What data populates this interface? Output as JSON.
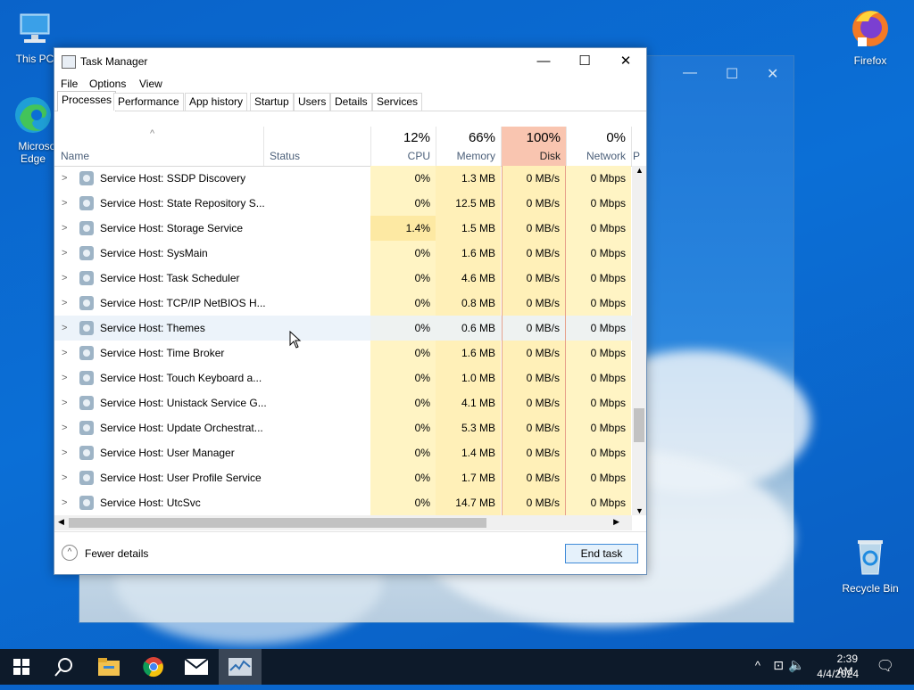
{
  "desktop": {
    "icons": [
      {
        "label": "This PC",
        "icon": "computer-icon"
      },
      {
        "label": "Microsoft Edge",
        "icon": "edge-icon"
      },
      {
        "label": "Firefox",
        "icon": "firefox-icon"
      },
      {
        "label": "Recycle Bin",
        "icon": "recycle-bin-icon"
      }
    ],
    "edge_label_line1": "Microsof",
    "edge_label_line2": "Edge"
  },
  "window": {
    "title": "Task Manager",
    "controls": {
      "minimize": "—",
      "maximize": "☐",
      "close": "✕"
    }
  },
  "menu": [
    "File",
    "Options",
    "View"
  ],
  "tabs": [
    "Processes",
    "Performance",
    "App history",
    "Startup",
    "Users",
    "Details",
    "Services"
  ],
  "active_tab": "Processes",
  "columns": {
    "name": "Name",
    "status": "Status",
    "cpu": {
      "pct": "12%",
      "label": "CPU"
    },
    "memory": {
      "pct": "66%",
      "label": "Memory"
    },
    "disk": {
      "pct": "100%",
      "label": "Disk"
    },
    "network": {
      "pct": "0%",
      "label": "Network"
    },
    "power_partial": "P"
  },
  "rows": [
    {
      "name": "Service Host: SSDP Discovery",
      "cpu": "0%",
      "memory": "1.3 MB",
      "disk": "0 MB/s",
      "network": "0 Mbps"
    },
    {
      "name": "Service Host: State Repository S...",
      "cpu": "0%",
      "memory": "12.5 MB",
      "disk": "0 MB/s",
      "network": "0 Mbps"
    },
    {
      "name": "Service Host: Storage Service",
      "cpu": "1.4%",
      "memory": "1.5 MB",
      "disk": "0 MB/s",
      "network": "0 Mbps"
    },
    {
      "name": "Service Host: SysMain",
      "cpu": "0%",
      "memory": "1.6 MB",
      "disk": "0 MB/s",
      "network": "0 Mbps"
    },
    {
      "name": "Service Host: Task Scheduler",
      "cpu": "0%",
      "memory": "4.6 MB",
      "disk": "0 MB/s",
      "network": "0 Mbps"
    },
    {
      "name": "Service Host: TCP/IP NetBIOS H...",
      "cpu": "0%",
      "memory": "0.8 MB",
      "disk": "0 MB/s",
      "network": "0 Mbps"
    },
    {
      "name": "Service Host: Themes",
      "cpu": "0%",
      "memory": "0.6 MB",
      "disk": "0 MB/s",
      "network": "0 Mbps"
    },
    {
      "name": "Service Host: Time Broker",
      "cpu": "0%",
      "memory": "1.6 MB",
      "disk": "0 MB/s",
      "network": "0 Mbps"
    },
    {
      "name": "Service Host: Touch Keyboard a...",
      "cpu": "0%",
      "memory": "1.0 MB",
      "disk": "0 MB/s",
      "network": "0 Mbps"
    },
    {
      "name": "Service Host: Unistack Service G...",
      "cpu": "0%",
      "memory": "4.1 MB",
      "disk": "0 MB/s",
      "network": "0 Mbps"
    },
    {
      "name": "Service Host: Update Orchestrat...",
      "cpu": "0%",
      "memory": "5.3 MB",
      "disk": "0 MB/s",
      "network": "0 Mbps"
    },
    {
      "name": "Service Host: User Manager",
      "cpu": "0%",
      "memory": "1.4 MB",
      "disk": "0 MB/s",
      "network": "0 Mbps"
    },
    {
      "name": "Service Host: User Profile Service",
      "cpu": "0%",
      "memory": "1.7 MB",
      "disk": "0 MB/s",
      "network": "0 Mbps"
    },
    {
      "name": "Service Host: UtcSvc",
      "cpu": "0%",
      "memory": "14.7 MB",
      "disk": "0 MB/s",
      "network": "0 Mbps"
    }
  ],
  "footer": {
    "fewer_details": "Fewer details",
    "end_task": "End task"
  },
  "taskbar": {
    "items": [
      "start-icon",
      "search-icon",
      "file-explorer-icon",
      "chrome-icon",
      "mail-icon",
      "task-manager-icon"
    ],
    "time": "2:39 AM",
    "date": "4/4/2024"
  },
  "colors": {
    "desktop": "#0b6fd6",
    "cpu_col": "#fff4c4",
    "disk_header": "#f9c5b0",
    "accent": "#3f8ad8"
  }
}
